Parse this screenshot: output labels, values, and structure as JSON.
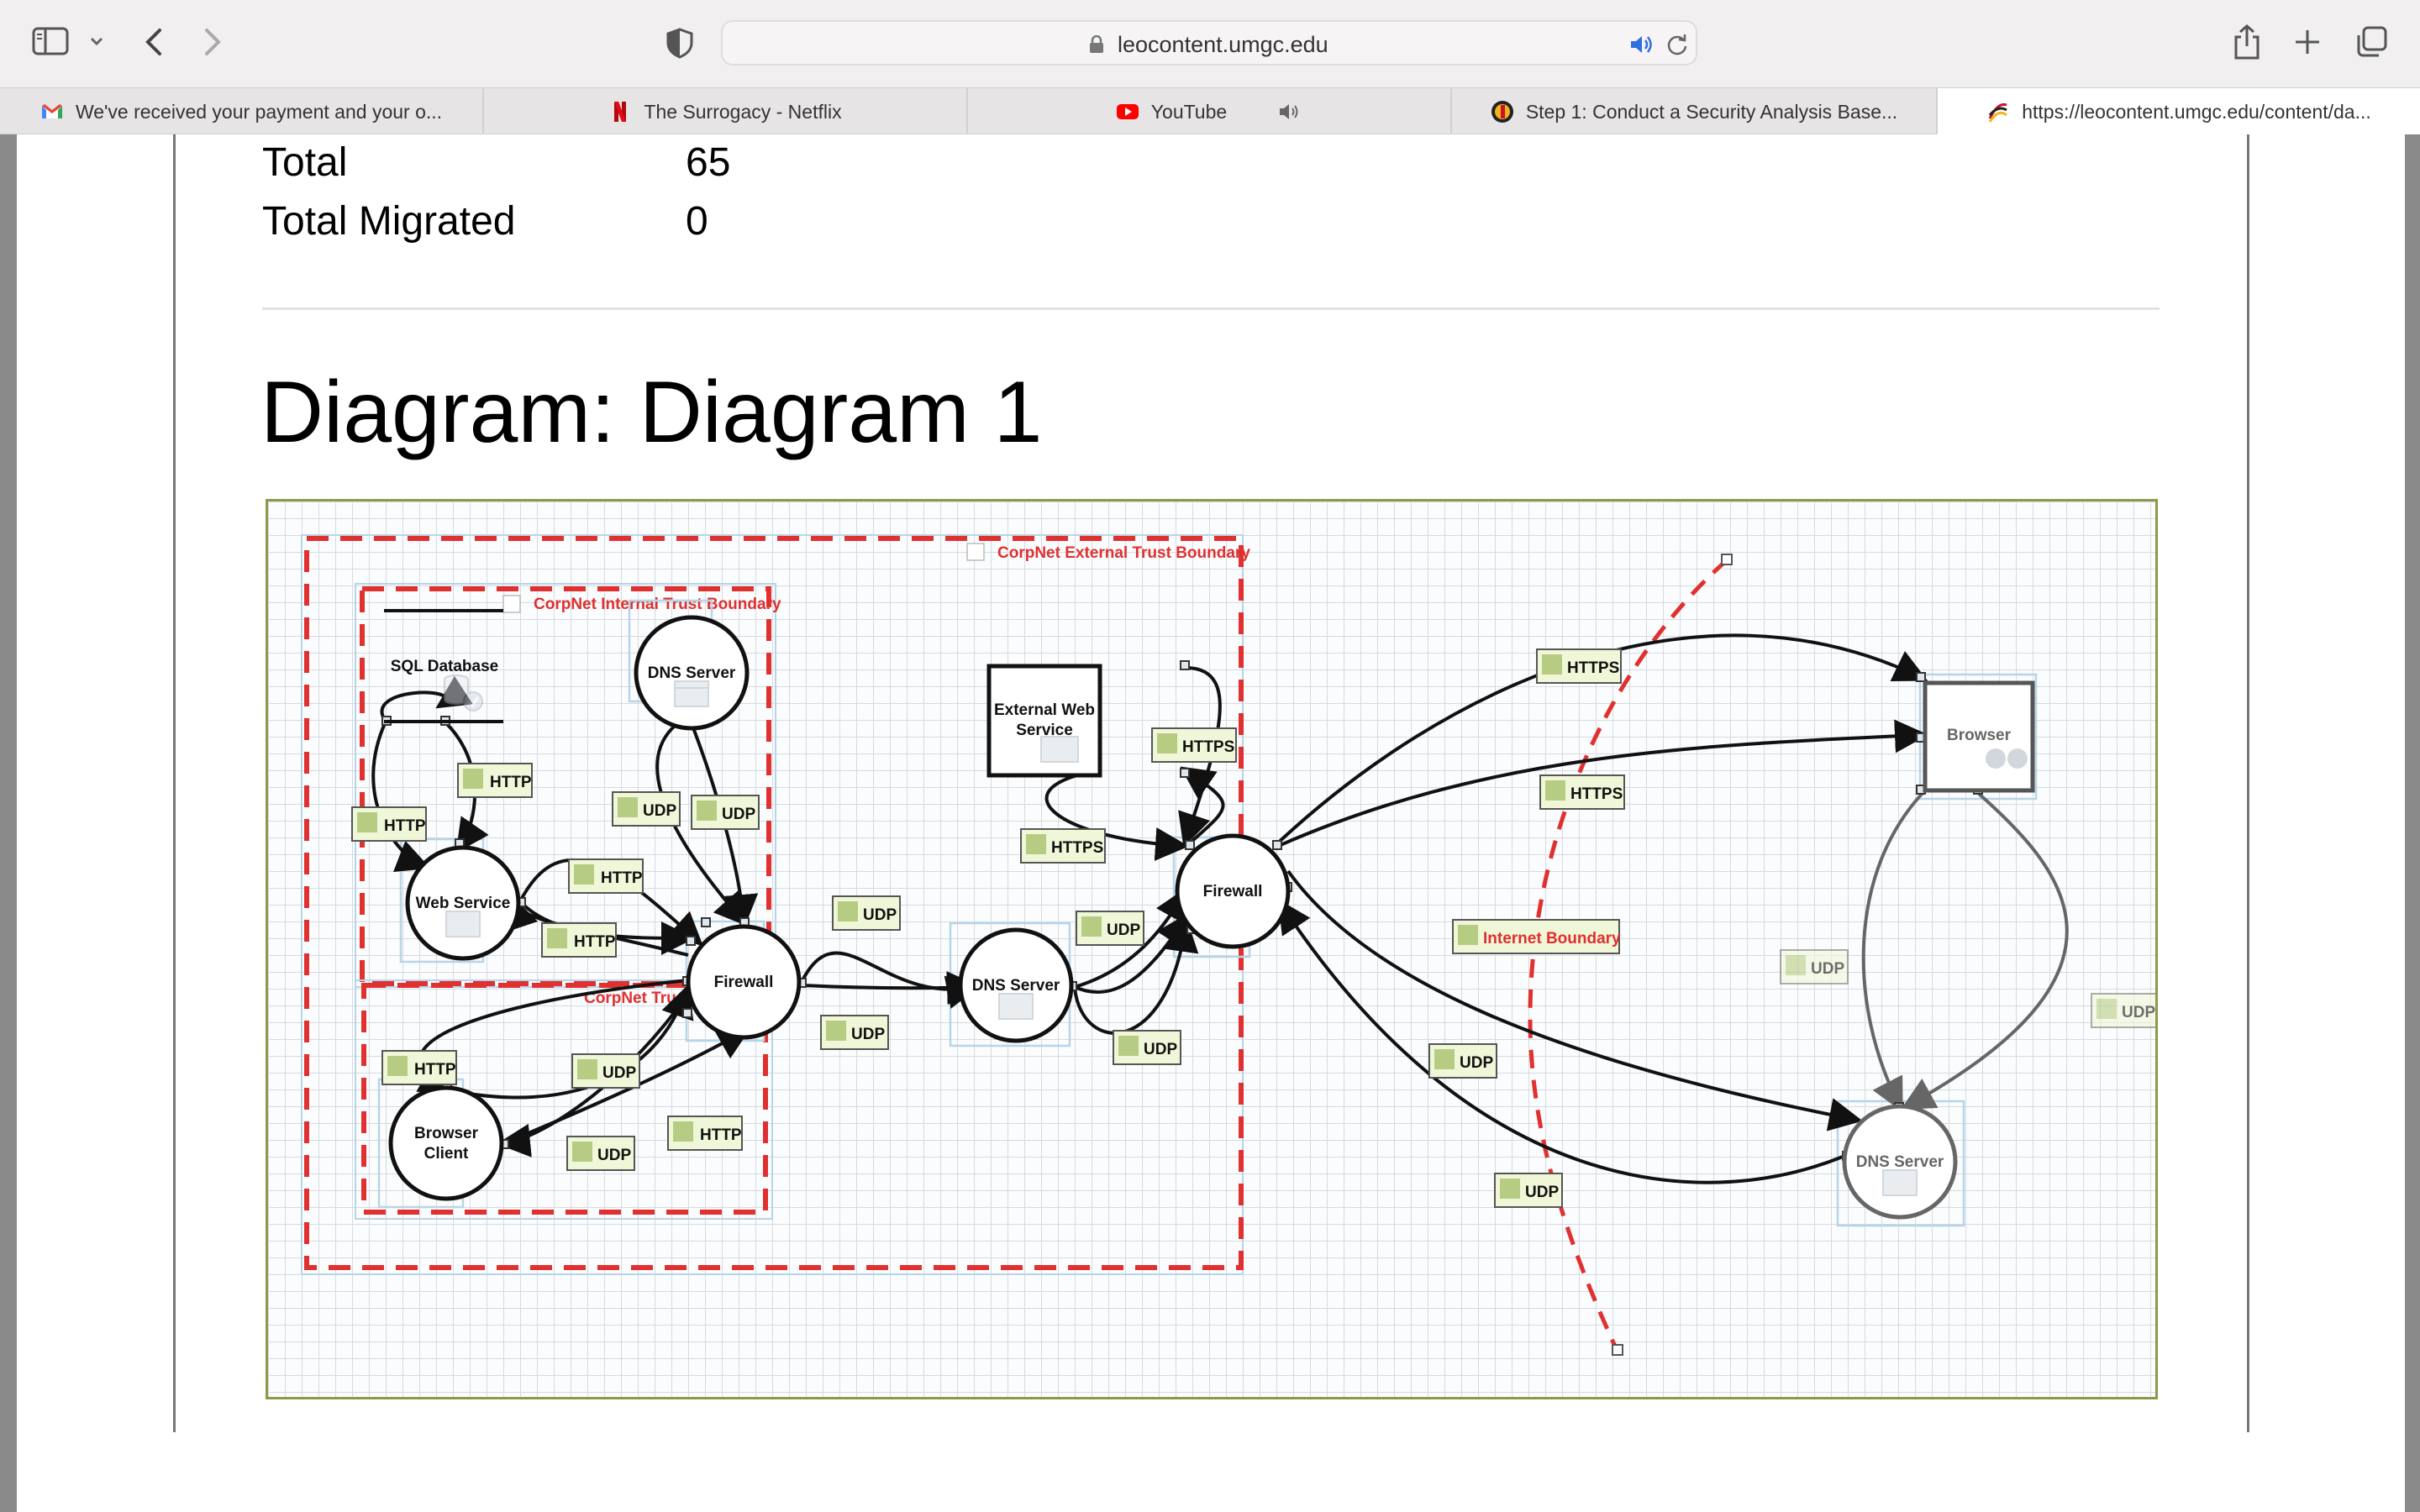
{
  "browser": {
    "url": "leocontent.umgc.edu",
    "tabs": [
      {
        "title": "We've received your payment and your o...",
        "icon": "gmail-icon"
      },
      {
        "title": "The Surrogacy - Netflix",
        "icon": "netflix-icon"
      },
      {
        "title": "YouTube",
        "icon": "youtube-icon"
      },
      {
        "title": "Step 1: Conduct a Security Analysis Base...",
        "icon": "umgc-icon"
      },
      {
        "title": "https://leocontent.umgc.edu/content/da...",
        "icon": "umgc-leo-icon"
      }
    ],
    "active_tab_index": 4
  },
  "document": {
    "stats": [
      {
        "label": "Total",
        "value": "65"
      },
      {
        "label": "Total Migrated",
        "value": "0"
      }
    ],
    "heading": "Diagram: Diagram 1"
  },
  "diagram": {
    "boundaries": {
      "external": "CorpNet External Trust Boundary",
      "internal": "CorpNet Internal Trust Boundary",
      "lower": "CorpNet Trust",
      "internet": "Internet Boundary"
    },
    "nodes": {
      "sql_db": "SQL Database",
      "dns_internal": "DNS Server",
      "web_service": "Web Service",
      "firewall_inner": "Firewall",
      "browser_client_1": "Browser",
      "browser_client_2": "Client",
      "dns_middle": "DNS Server",
      "ext_web_1": "External Web",
      "ext_web_2": "Service",
      "firewall_outer": "Firewall",
      "browser": "Browser",
      "dns_external": "DNS Server"
    },
    "flows": {
      "http": "HTTP",
      "https": "HTTPS",
      "udp": "UDP"
    }
  },
  "colors": {
    "boundary": "#e03030",
    "grid_line": "#d6dbe1",
    "frame": "#8c9a4a",
    "flow_label_bg": "#f0f6d8"
  }
}
